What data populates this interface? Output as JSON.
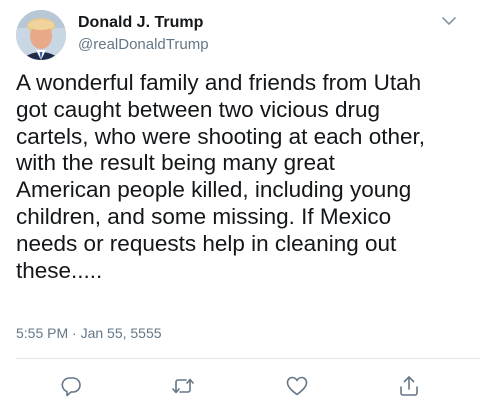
{
  "author": {
    "name": "Donald J. Trump",
    "handle": "@realDonaldTrump"
  },
  "tweet": {
    "text": "A wonderful family and friends from Utah\ngot caught between two vicious drug\ncartels, who were shooting at each other,\nwith the result being many great\nAmerican people killed, including young\nchildren, and some missing. If Mexico\nneeds or requests help in cleaning out\nthese.....",
    "timestamp": "5:55 PM · Jan 55, 5555"
  },
  "icons": {
    "menu": "chevron-down-icon",
    "reply": "reply-icon",
    "retweet": "retweet-icon",
    "like": "heart-icon",
    "share": "share-icon"
  },
  "colors": {
    "text": "#14171a",
    "secondary": "#657786",
    "divider": "#e1e8ed"
  }
}
